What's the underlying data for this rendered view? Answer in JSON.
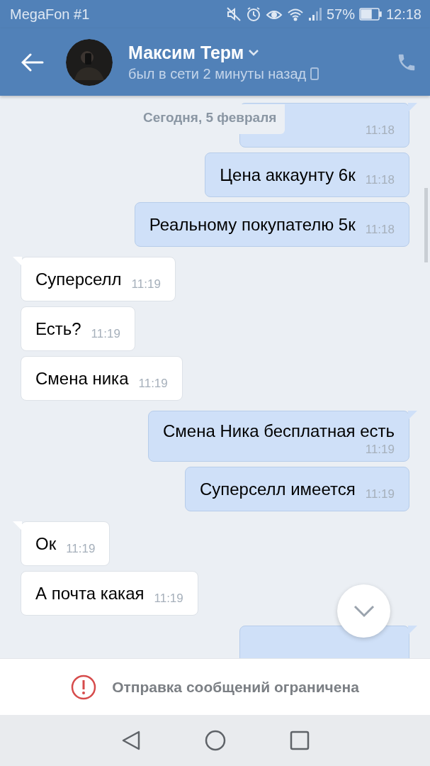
{
  "status_bar": {
    "carrier": "MegaFon #1",
    "battery_percent": "57%",
    "time": "12:18"
  },
  "header": {
    "name": "Максим Терм",
    "last_seen": "был в сети 2 минуты назад"
  },
  "date_divider": "Сегодня, 5 февраля",
  "messages": [
    {
      "kind": "outgoing",
      "time": "11:18",
      "group_start": true
    },
    {
      "kind": "outgoing",
      "text": "Цена аккаунту 6к",
      "time": "11:18",
      "group_start": false
    },
    {
      "kind": "outgoing",
      "text": "Реальному покупателю 5к",
      "time": "11:18",
      "group_start": false
    },
    {
      "kind": "incoming",
      "text": "Суперселл",
      "time": "11:19",
      "group_start": true
    },
    {
      "kind": "incoming",
      "text": "Есть?",
      "time": "11:19",
      "group_start": false
    },
    {
      "kind": "incoming",
      "text": "Смена ника",
      "time": "11:19",
      "group_start": false
    },
    {
      "kind": "outgoing",
      "text": "Смена Ника бесплатная есть",
      "time": "11:19",
      "group_start": true,
      "time_below": true
    },
    {
      "kind": "outgoing",
      "text": "Суперселл имеется",
      "time": "11:19",
      "group_start": false
    },
    {
      "kind": "incoming",
      "text": "Ок",
      "time": "11:19",
      "group_start": true
    },
    {
      "kind": "incoming",
      "text": "А почта какая",
      "time": "11:19",
      "group_start": false
    },
    {
      "kind": "outgoing",
      "group_start": true
    }
  ],
  "restriction_notice": "Отправка сообщений ограничена"
}
